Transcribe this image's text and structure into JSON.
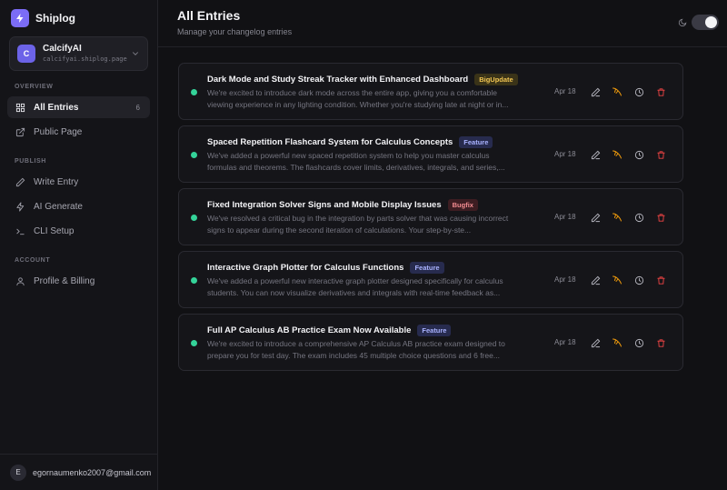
{
  "brand": {
    "name": "Shiplog"
  },
  "project": {
    "initial": "C",
    "name": "CalcifyAI",
    "url": "calcifyai.shiplog.page"
  },
  "sidebar": {
    "sections": [
      "OVERVIEW",
      "PUBLISH",
      "ACCOUNT"
    ],
    "items": [
      {
        "label": "All Entries",
        "icon": "grid-icon",
        "count": "6",
        "active": true
      },
      {
        "label": "Public Page",
        "icon": "external-link-icon"
      },
      {
        "label": "Write Entry",
        "icon": "pen-icon"
      },
      {
        "label": "AI Generate",
        "icon": "lightning-icon"
      },
      {
        "label": "CLI Setup",
        "icon": "terminal-icon"
      },
      {
        "label": "Profile & Billing",
        "icon": "user-icon"
      }
    ]
  },
  "user": {
    "initial": "E",
    "email": "egornaumenko2007@gmail.com"
  },
  "header": {
    "title": "All Entries",
    "subtitle": "Manage your changelog entries"
  },
  "colors": {
    "accent": "#7b6cf6",
    "status_published": "#34d399",
    "delete": "#ef4444",
    "feather": "#f59e0b"
  },
  "entries": [
    {
      "title": "Dark Mode and Study Streak Tracker with Enhanced Dashboard",
      "badge": "BigUpdate",
      "badge_type": "bigupdate",
      "description": "We're excited to introduce dark mode across the entire app, giving you a comfortable viewing experience in any lighting condition. Whether you're studying late at night or in...",
      "date": "Apr 18"
    },
    {
      "title": "Spaced Repetition Flashcard System for Calculus Concepts",
      "badge": "Feature",
      "badge_type": "feature",
      "description": "We've added a powerful new spaced repetition system to help you master calculus formulas and theorems. The flashcards cover limits, derivatives, integrals, and series,...",
      "date": "Apr 18"
    },
    {
      "title": "Fixed Integration Solver Signs and Mobile Display Issues",
      "badge": "Bugfix",
      "badge_type": "bugfix",
      "description": "We've resolved a critical bug in the integration by parts solver that was causing incorrect signs to appear during the second iteration of calculations. Your step-by-ste...",
      "date": "Apr 18"
    },
    {
      "title": "Interactive Graph Plotter for Calculus Functions",
      "badge": "Feature",
      "badge_type": "feature",
      "description": "We've added a powerful new interactive graph plotter designed specifically for calculus students. You can now visualize derivatives and integrals with real-time feedback as...",
      "date": "Apr 18"
    },
    {
      "title": "Full AP Calculus AB Practice Exam Now Available",
      "badge": "Feature",
      "badge_type": "feature",
      "description": "We're excited to introduce a comprehensive AP Calculus AB practice exam designed to prepare you for test day. The exam includes 45 multiple choice questions and 6 free...",
      "date": "Apr 18"
    }
  ]
}
